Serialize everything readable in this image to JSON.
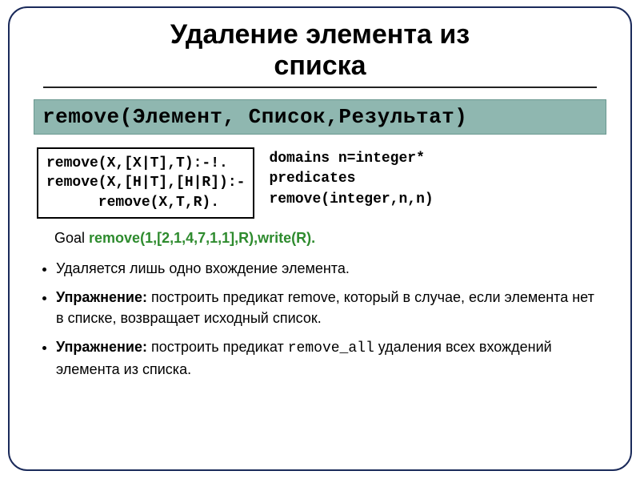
{
  "title_line1": "Удаление элемента из",
  "title_line2": "списка",
  "signature": "remove(Элемент, Список,Результат)",
  "code_rules": "remove(X,[X|T],T):-!.\nremove(X,[H|T],[H|R]):-\n      remove(X,T,R).",
  "declarations": "domains n=integer*\npredicates\nremove(integer,n,n)",
  "goal_label": "Goal ",
  "goal_code": "remove(1,[2,1,4,7,1,1],R),write(R).",
  "bullets": {
    "b1": "Удаляется лишь одно вхождение элемента.",
    "b2_label": "Упражнение:",
    "b2_text": " построить предикат remove, который в случае, если элемента нет в списке, возвращает исходный список.",
    "b3_label": "Упражнение:",
    "b3_text_a": " построить предикат ",
    "b3_code": "remove_all",
    "b3_text_b": " удаления всех вхождений элемента из списка."
  }
}
